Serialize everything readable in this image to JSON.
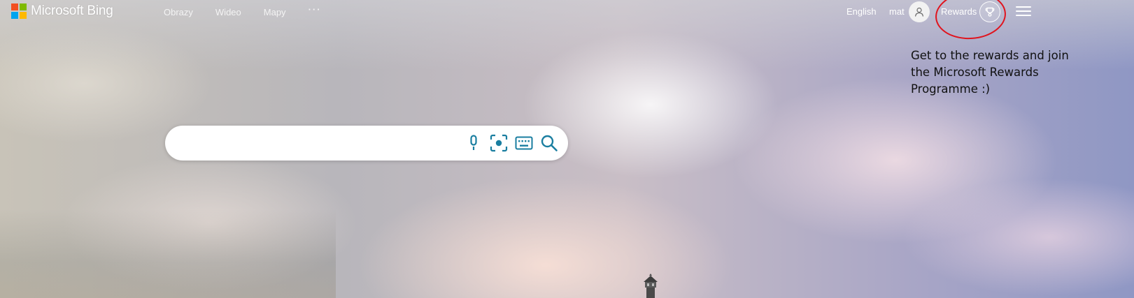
{
  "brand": {
    "name": "Microsoft Bing",
    "logo_colors": [
      "#f25022",
      "#7fba00",
      "#00a4ef",
      "#ffb900"
    ]
  },
  "nav": {
    "items": [
      {
        "label": "Obrazy"
      },
      {
        "label": "Wideo"
      },
      {
        "label": "Mapy"
      }
    ],
    "more_label": "···"
  },
  "header": {
    "language_label": "English",
    "user_name": "mat",
    "rewards_label": "Rewards",
    "avatar_icon": "person-icon",
    "rewards_icon": "trophy-icon",
    "menu_icon": "hamburger-menu-icon"
  },
  "annotation": {
    "text": "Get to the rewards and join the Microsoft Rewards Programme :)",
    "highlight_color": "#e0141e"
  },
  "search": {
    "value": "",
    "placeholder": "",
    "accent_color": "#1a7ea0",
    "icons": [
      "microphone-icon",
      "visual-search-icon",
      "keyboard-icon",
      "search-icon"
    ]
  }
}
